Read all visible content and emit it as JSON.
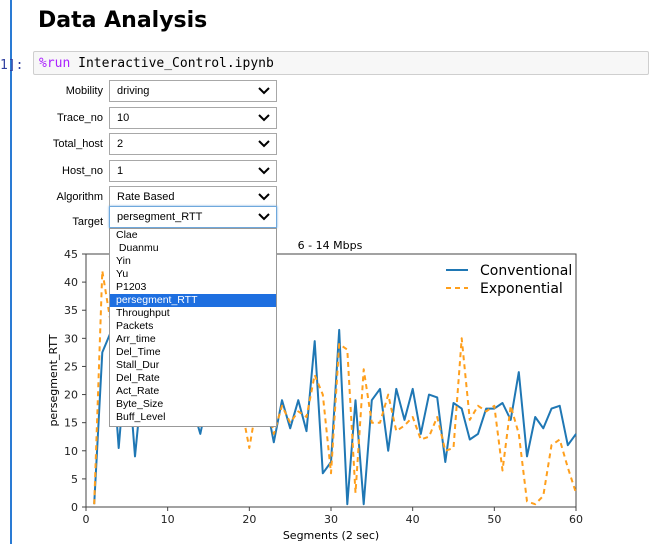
{
  "notebook": {
    "heading": "Data Analysis",
    "prompt": "1]:",
    "code_magic": "%run",
    "code_rest": " Interactive_Control.ipynb"
  },
  "controls": [
    {
      "label": "Mobility",
      "value": "driving"
    },
    {
      "label": "Trace_no",
      "value": "10"
    },
    {
      "label": "Total_host",
      "value": "2"
    },
    {
      "label": "Host_no",
      "value": "1"
    },
    {
      "label": "Algorithm",
      "value": "Rate Based"
    },
    {
      "label": "Target",
      "value": "persegment_RTT"
    }
  ],
  "dropdown": {
    "items": [
      "Clae",
      " Duanmu",
      "Yin",
      "Yu",
      "P1203",
      "persegment_RTT",
      "Throughput",
      "Packets",
      "Arr_time",
      "Del_Time",
      "Stall_Dur",
      "Del_Rate",
      "Act_Rate",
      "Byte_Size",
      "Buff_Level"
    ],
    "selected_index": 5
  },
  "colors": {
    "conventional": "#1f77b4",
    "exponential": "#ff9f1c",
    "accent": "#2a7bd4"
  },
  "chart_data": {
    "type": "line",
    "title": "6 - 14 Mbps",
    "xlabel": "Segments (2 sec)",
    "ylabel": "persegment_RTT",
    "xlim": [
      0,
      60
    ],
    "ylim": [
      0,
      45
    ],
    "xticks": [
      0,
      10,
      20,
      30,
      40,
      50,
      60
    ],
    "yticks": [
      0,
      5,
      10,
      15,
      20,
      25,
      30,
      35,
      40,
      45
    ],
    "legend_position": "top-right",
    "series": [
      {
        "name": "Conventional",
        "style": "solid",
        "x": [
          1,
          2,
          3,
          4,
          5,
          6,
          7,
          8,
          9,
          10,
          11,
          12,
          13,
          14,
          15,
          16,
          17,
          18,
          19,
          20,
          21,
          22,
          23,
          24,
          25,
          26,
          27,
          28,
          29,
          30,
          31,
          32,
          33,
          34,
          35,
          36,
          37,
          38,
          39,
          40,
          41,
          42,
          43,
          44,
          45,
          46,
          47,
          48,
          49,
          50,
          51,
          52,
          53,
          54,
          55,
          56,
          57,
          58,
          59,
          60
        ],
        "y": [
          0.5,
          27.5,
          31,
          10.5,
          28,
          9,
          24,
          19,
          22,
          17,
          20,
          18,
          18,
          13,
          20,
          17,
          19,
          15,
          21,
          15,
          18,
          19,
          11.5,
          19,
          14,
          19,
          13.5,
          29.5,
          6,
          8,
          31.5,
          0.5,
          19,
          0.5,
          19,
          21,
          10,
          21,
          15.5,
          21,
          13,
          20,
          19.5,
          8,
          18.5,
          17.5,
          12,
          13,
          17.5,
          17.5,
          18.5,
          15.5,
          24,
          9,
          16,
          14,
          17.5,
          18,
          11,
          13
        ]
      },
      {
        "name": "Exponential",
        "style": "dashed",
        "x": [
          1,
          2,
          3,
          4,
          5,
          6,
          7,
          8,
          9,
          10,
          11,
          12,
          13,
          14,
          15,
          16,
          17,
          18,
          19,
          20,
          21,
          22,
          23,
          24,
          25,
          26,
          27,
          28,
          29,
          30,
          31,
          32,
          33,
          34,
          35,
          36,
          37,
          38,
          39,
          40,
          41,
          42,
          43,
          44,
          45,
          46,
          47,
          48,
          49,
          50,
          51,
          52,
          53,
          54,
          55,
          56,
          57,
          58,
          59,
          60
        ],
        "y": [
          0.5,
          42,
          33,
          15,
          20,
          17,
          21,
          19,
          18,
          20,
          19,
          18,
          17,
          18,
          19,
          16,
          20,
          17,
          18,
          10.5,
          19,
          20,
          13,
          18,
          15,
          17,
          16,
          23.5,
          20,
          6,
          29,
          28,
          2.5,
          24.5,
          15,
          15,
          20,
          13.5,
          14.5,
          16,
          12,
          12.5,
          16,
          10,
          10.5,
          30,
          15.5,
          18,
          17,
          18,
          6.5,
          18,
          13,
          1,
          0.5,
          2,
          11,
          12,
          7,
          2.5
        ]
      }
    ]
  }
}
